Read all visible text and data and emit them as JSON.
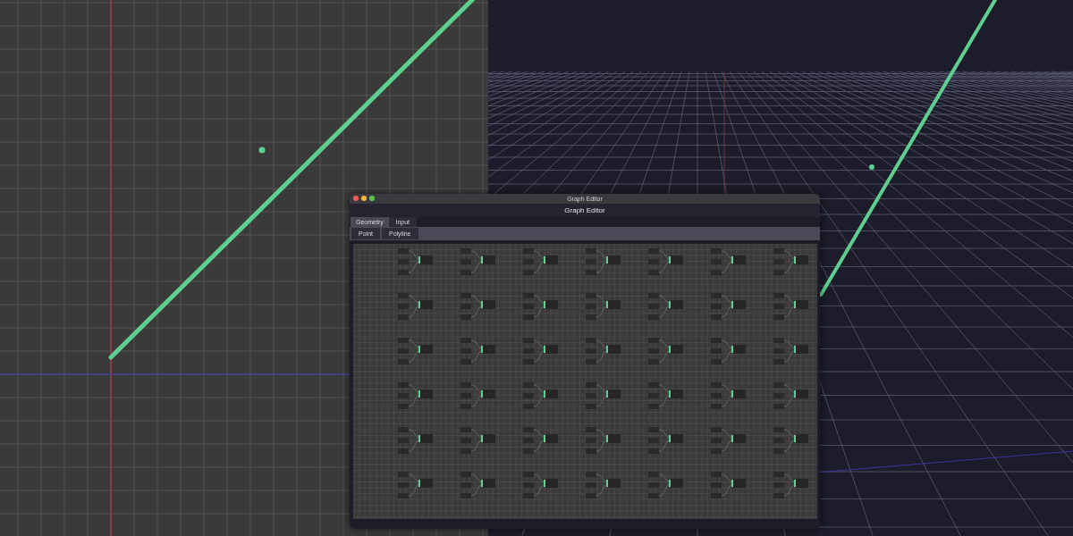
{
  "window": {
    "title": "Graph Editor"
  },
  "panel": {
    "title": "Graph Editor"
  },
  "tabs": [
    {
      "label": "Geometry",
      "selected": true
    },
    {
      "label": "Input",
      "selected": false
    }
  ],
  "buttons": [
    "Point",
    "Polyline"
  ]
}
